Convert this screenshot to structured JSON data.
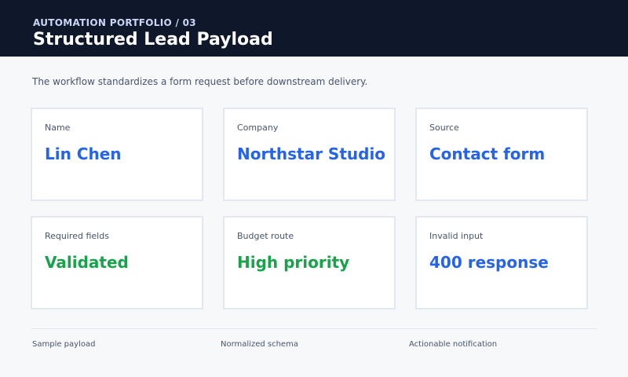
{
  "header": {
    "eyebrow": "AUTOMATION PORTFOLIO / 03",
    "title": "Structured Lead Payload"
  },
  "subtitle": "The workflow standardizes a form request before downstream delivery.",
  "cards": [
    {
      "label": "Name",
      "value": "Lin Chen",
      "color": "#2563eb"
    },
    {
      "label": "Company",
      "value": "Northstar Studio",
      "color": "#2563eb"
    },
    {
      "label": "Source",
      "value": "Contact form",
      "color": "#2563eb"
    },
    {
      "label": "Required fields",
      "value": "Validated",
      "color": "#16a34a"
    },
    {
      "label": "Budget route",
      "value": "High priority",
      "color": "#16a34a"
    },
    {
      "label": "Invalid input",
      "value": "400 response",
      "color": "#2563eb"
    }
  ],
  "footer": [
    "Sample payload",
    "Normalized schema",
    "Actionable notification"
  ]
}
